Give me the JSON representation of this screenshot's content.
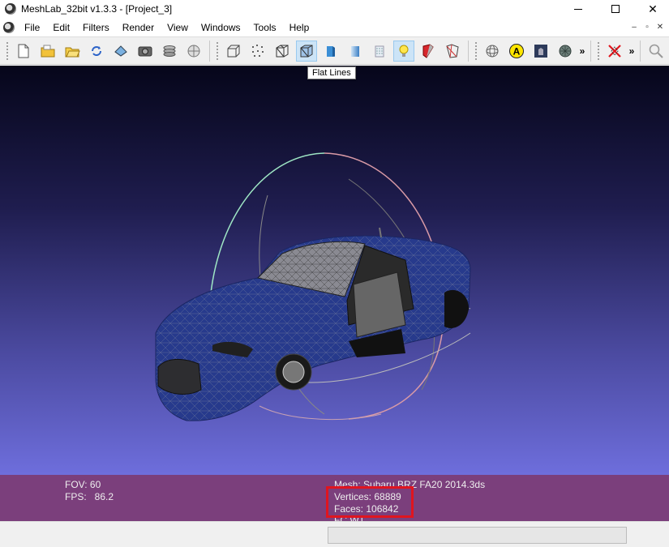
{
  "window": {
    "title": "MeshLab_32bit v1.3.3 - [Project_3]",
    "minimize": "",
    "maximize": "",
    "close": "✕"
  },
  "menu": {
    "items": [
      "File",
      "Edit",
      "Filters",
      "Render",
      "View",
      "Windows",
      "Tools",
      "Help"
    ],
    "mdi_min": "–",
    "mdi_restore": "▫",
    "mdi_close": "✕"
  },
  "toolbar": {
    "overflow_1": "»",
    "overflow_2": "»",
    "icons": [
      "new-icon",
      "open-icon",
      "open-project-icon",
      "reload-icon",
      "save-icon",
      "snapshot-icon",
      "layers-icon",
      "decorate-icon",
      "bbox-icon",
      "points-icon",
      "wireframe-icon",
      "flat-lines-icon",
      "flat-icon",
      "smooth-icon",
      "texture-icon",
      "light-icon",
      "backface-icon",
      "selection-icon",
      "trackball-icon",
      "axis-icon",
      "texture-mode-icon",
      "color-mode-icon",
      "edit-disable-icon",
      "search-icon"
    ]
  },
  "tooltip": {
    "text": "Flat Lines"
  },
  "info": {
    "fov": "FOV: 60",
    "fps": "FPS:   86.2",
    "mesh": "Mesh: Subaru BRZ FA20 2014.3ds",
    "vertices": "Vertices: 68889",
    "faces": "Faces: 106842",
    "extra": "FC WT"
  },
  "colors": {
    "info_panel": "#7b3f7c",
    "highlight": "#e0151f",
    "car_body": "#273a8c"
  }
}
